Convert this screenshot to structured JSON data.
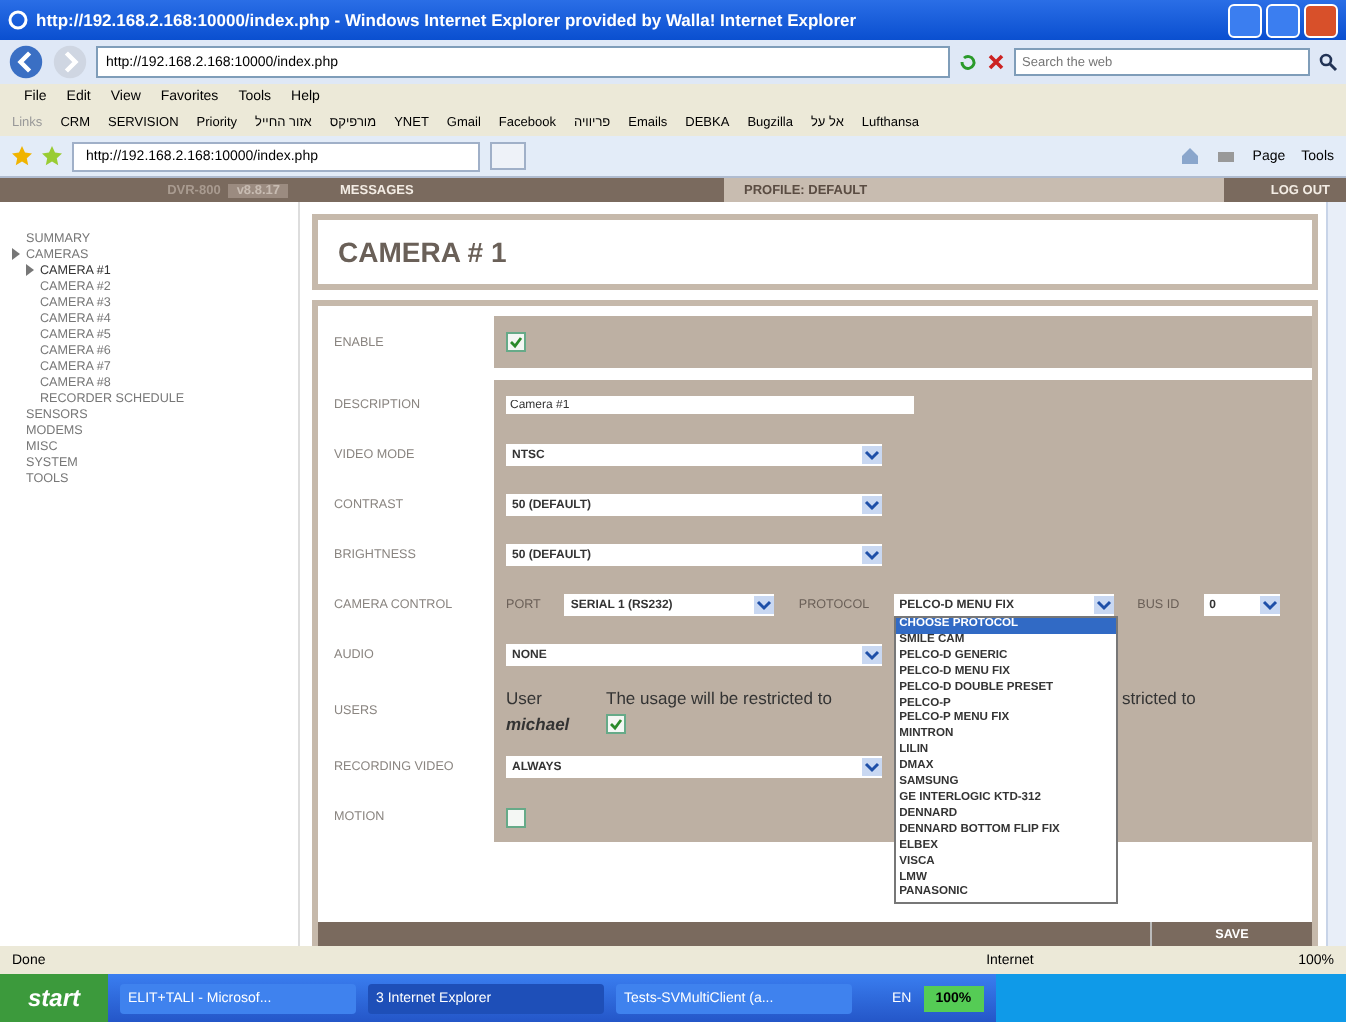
{
  "browser": {
    "title": "http://192.168.2.168:10000/index.php - Windows Internet Explorer provided by Walla! Internet Explorer",
    "address": "http://192.168.2.168:10000/index.php",
    "search_placeholder": "Search the web",
    "menu": [
      "File",
      "Edit",
      "View",
      "Favorites",
      "Tools",
      "Help"
    ],
    "links_label": "Links",
    "links": [
      "CRM",
      "SERVISION",
      "Priority",
      "אזור החייל",
      "מורפיקס",
      "YNET",
      "Gmail",
      "Facebook",
      "פריוויה",
      "Emails",
      "DEBKA",
      "Bugzilla",
      "אל על",
      "Lufthansa"
    ],
    "tab": "http://192.168.2.168:10000/index.php",
    "commands": [
      "Page",
      "Tools"
    ]
  },
  "app_header": {
    "product": "DVR-800",
    "version": "v8.8.17",
    "messages": "MESSAGES",
    "profile": "PROFILE: DEFAULT",
    "logout": "LOG OUT"
  },
  "sidebar": {
    "items": [
      {
        "label": "SUMMARY",
        "selected": false
      },
      {
        "label": "CAMERAS",
        "selected": false,
        "expanded": true,
        "children": [
          {
            "label": "CAMERA #1",
            "selected": true
          },
          {
            "label": "CAMERA #2",
            "selected": false
          },
          {
            "label": "CAMERA #3",
            "selected": false
          },
          {
            "label": "CAMERA #4",
            "selected": false
          },
          {
            "label": "CAMERA #5",
            "selected": false
          },
          {
            "label": "CAMERA #6",
            "selected": false
          },
          {
            "label": "CAMERA #7",
            "selected": false
          },
          {
            "label": "CAMERA #8",
            "selected": false
          },
          {
            "label": "RECORDER SCHEDULE",
            "selected": false
          }
        ]
      },
      {
        "label": "SENSORS",
        "selected": false
      },
      {
        "label": "MODEMS",
        "selected": false
      },
      {
        "label": "MISC",
        "selected": false
      },
      {
        "label": "SYSTEM",
        "selected": false
      },
      {
        "label": "TOOLS",
        "selected": false
      }
    ]
  },
  "page_title": "CAMERA # 1",
  "form": {
    "rows": [
      {
        "kind": "checkbox",
        "label": "ENABLE",
        "checked": true
      },
      {
        "kind": "text",
        "label": "DESCRIPTION",
        "value": "Camera #1"
      },
      {
        "kind": "select",
        "label": "VIDEO MODE",
        "value": "NTSC"
      },
      {
        "kind": "select",
        "label": "CONTRAST",
        "value": "50 (DEFAULT)"
      },
      {
        "kind": "select",
        "label": "BRIGHTNESS",
        "value": "50 (DEFAULT)"
      },
      {
        "kind": "camera_control",
        "label": "CAMERA CONTROL",
        "port_label": "PORT",
        "port": "SERIAL 1 (RS232)",
        "protocol_label": "PROTOCOL",
        "protocol": "PELCO-D MENU FIX",
        "bus_label": "BUS ID",
        "bus": "0"
      },
      {
        "kind": "select",
        "label": "AUDIO",
        "value": "NONE"
      },
      {
        "kind": "users",
        "label": "USERS",
        "user_label": "User",
        "user_name": "michael",
        "note": "The usage will be restricted to",
        "note_tail": "stricted to",
        "checked": true
      },
      {
        "kind": "select",
        "label": "RECORDING VIDEO",
        "value": "ALWAYS"
      },
      {
        "kind": "checkbox",
        "label": "MOTION",
        "checked": false
      }
    ],
    "save": "SAVE"
  },
  "protocol_dropdown": {
    "options": [
      {
        "label": "CHOOSE PROTOCOL",
        "selected": true
      },
      {
        "label": "SMILE CAM",
        "selected": false
      },
      {
        "label": "PELCO-D GENERIC",
        "selected": false
      },
      {
        "label": "PELCO-D MENU FIX",
        "selected": false
      },
      {
        "label": "PELCO-D DOUBLE PRESET",
        "selected": false
      },
      {
        "label": "PELCO-P",
        "selected": false
      },
      {
        "label": "PELCO-P MENU FIX",
        "selected": false
      },
      {
        "label": "MINTRON",
        "selected": false
      },
      {
        "label": "LILIN",
        "selected": false
      },
      {
        "label": "DMAX",
        "selected": false
      },
      {
        "label": "SAMSUNG",
        "selected": false
      },
      {
        "label": "GE INTERLOGIC KTD-312",
        "selected": false
      },
      {
        "label": "DENNARD",
        "selected": false
      },
      {
        "label": "DENNARD BOTTOM FLIP FIX",
        "selected": false
      },
      {
        "label": "ELBEX",
        "selected": false
      },
      {
        "label": "VISCA",
        "selected": false
      },
      {
        "label": "LMW",
        "selected": false
      },
      {
        "label": "PANASONIC",
        "selected": false
      }
    ]
  },
  "status_bar": {
    "text": "Done",
    "zone": "Internet",
    "zoom": "100%"
  },
  "taskbar": {
    "start": "start",
    "tasks": [
      {
        "label": "ELIT+TALI - Microsof...",
        "selected": false
      },
      {
        "label": "3 Internet Explorer",
        "selected": true
      },
      {
        "label": "Tests-SVMultiClient (a...",
        "selected": false
      }
    ],
    "language": "EN",
    "battery": "100%"
  }
}
